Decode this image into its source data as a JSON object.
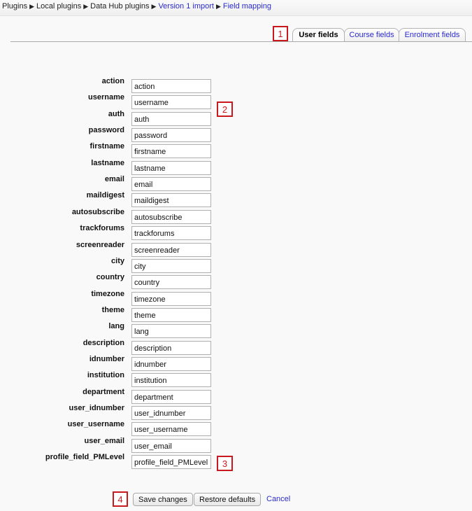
{
  "breadcrumb": {
    "items": [
      "Plugins",
      "Local plugins",
      "Data Hub plugins",
      "Version 1 import",
      "Field mapping"
    ],
    "separator": "▶"
  },
  "tabs": [
    {
      "label": "User fields",
      "active": true
    },
    {
      "label": "Course fields",
      "active": false
    },
    {
      "label": "Enrolment fields",
      "active": false
    }
  ],
  "markers": [
    "1",
    "2",
    "3",
    "4"
  ],
  "fields": [
    {
      "label": "action",
      "value": "action"
    },
    {
      "label": "username",
      "value": "username"
    },
    {
      "label": "auth",
      "value": "auth"
    },
    {
      "label": "password",
      "value": "password"
    },
    {
      "label": "firstname",
      "value": "firstname"
    },
    {
      "label": "lastname",
      "value": "lastname"
    },
    {
      "label": "email",
      "value": "email"
    },
    {
      "label": "maildigest",
      "value": "maildigest"
    },
    {
      "label": "autosubscribe",
      "value": "autosubscribe"
    },
    {
      "label": "trackforums",
      "value": "trackforums"
    },
    {
      "label": "screenreader",
      "value": "screenreader"
    },
    {
      "label": "city",
      "value": "city"
    },
    {
      "label": "country",
      "value": "country"
    },
    {
      "label": "timezone",
      "value": "timezone"
    },
    {
      "label": "theme",
      "value": "theme"
    },
    {
      "label": "lang",
      "value": "lang"
    },
    {
      "label": "description",
      "value": "description"
    },
    {
      "label": "idnumber",
      "value": "idnumber"
    },
    {
      "label": "institution",
      "value": "institution"
    },
    {
      "label": "department",
      "value": "department"
    },
    {
      "label": "user_idnumber",
      "value": "user_idnumber"
    },
    {
      "label": "user_username",
      "value": "user_username"
    },
    {
      "label": "user_email",
      "value": "user_email"
    },
    {
      "label": "profile_field_PMLevel",
      "value": "profile_field_PMLevel"
    }
  ],
  "actions": {
    "save_label": "Save changes",
    "restore_label": "Restore defaults",
    "cancel_label": "Cancel"
  },
  "colors": {
    "link": "#2a2ad0",
    "marker": "#c8191e"
  }
}
